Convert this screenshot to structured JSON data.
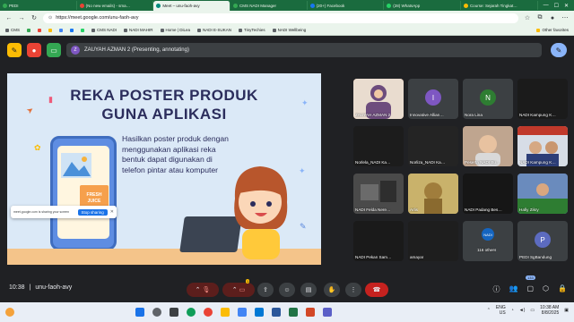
{
  "browser": {
    "tabs": [
      {
        "label": "PEDI",
        "color": "#34a853"
      },
      {
        "label": "(No new emails) - sma…",
        "color": "#ea4335"
      },
      {
        "label": "Meet – unu-faoh-avy",
        "color": "#00897b",
        "active": true
      },
      {
        "label": "CMS NADI Manager",
        "color": "#34a853"
      },
      {
        "label": "(20+) Facebook",
        "color": "#1877f2"
      },
      {
        "label": "(28) WhatsApp",
        "color": "#25d366"
      },
      {
        "label": "Course: Sejarah Tingkat…",
        "color": "#fbbc04"
      }
    ],
    "url": "https://meet.google.com/unu-faoh-avy",
    "bookmarks": [
      "CMS",
      "",
      "",
      "",
      "",
      "",
      "",
      "CMS NADI",
      "NADI MAHIR",
      "Home | DiLea",
      "NADI E-SUKAN",
      "TinyTechies",
      "NADI Wellbeing"
    ],
    "other_bookmarks": "Other favorites"
  },
  "meet": {
    "presenter_avatar_letter": "Z",
    "presenter_label": "ZAUYAH AZMAN 2 (Presenting, annotating)",
    "slide": {
      "title_line1": "REKA POSTER PRODUK",
      "title_line2": "GUNA APLIKASI",
      "body": "Hasilkan poster produk dengan menggunakan aplikasi reka bentuk dapat digunakan di telefon pintar atau komputer",
      "juice_label": "FRESH JUICE",
      "popup_text": "meet.google.com is sharing your screen",
      "popup_button": "Stop sharing",
      "popup_close": "✕"
    },
    "participants": [
      {
        "name": "ZAUYAH AZMAN 2",
        "type": "video",
        "color": "#c98a6b"
      },
      {
        "name": "Innovative Allian…",
        "type": "avatar",
        "letter": "I",
        "color": "#7e57c2"
      },
      {
        "name": "Nora Lina",
        "type": "avatar",
        "letter": "N",
        "color": "#2e7d32"
      },
      {
        "name": "NADI Kampung K…",
        "type": "video",
        "color": "#1b1b1b"
      },
      {
        "name": "Norlela_NADI Ka…",
        "type": "video",
        "color": "#1c1c1c"
      },
      {
        "name": "Norliza_NADI Ka…",
        "type": "video",
        "color": "#242424"
      },
      {
        "name": "Peserta NADI Bu…",
        "type": "video",
        "color": "#8d6e63"
      },
      {
        "name": "NADI Kampung K…",
        "type": "video",
        "color": "#5d7fa8"
      },
      {
        "name": "NADI Felda Nere…",
        "type": "video",
        "color": "#3a3a3a"
      },
      {
        "name": "Arlis",
        "type": "video",
        "color": "#b59d58"
      },
      {
        "name": "NADI Padang Bes…",
        "type": "video",
        "color": "#161616"
      },
      {
        "name": "Hafiy Zikry",
        "type": "video",
        "color": "#4a6fa5"
      },
      {
        "name": "NADI Pekan Sam…",
        "type": "video",
        "color": "#1a1a1a"
      },
      {
        "name": "amayar",
        "type": "video",
        "color": "#1e1e1e"
      },
      {
        "name": "116 others",
        "type": "others",
        "color": "#3c4043"
      },
      {
        "name": "PEDI SgBandung",
        "type": "avatar",
        "letter": "P",
        "color": "#5c6bc0"
      }
    ],
    "time": "10:38",
    "meeting_code": "unu-faoh-avy",
    "participant_count": "133",
    "raise_hand_badge": "1"
  },
  "taskbar": {
    "lang": "ENG",
    "region": "US",
    "time": "10:38 AM",
    "date": "8/8/2025"
  }
}
